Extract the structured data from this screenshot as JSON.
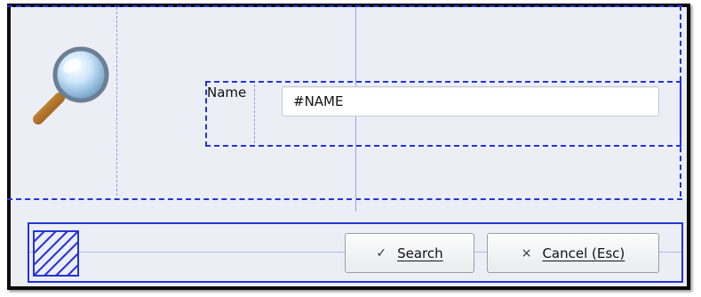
{
  "search_form": {
    "field_label": "Name",
    "field_value": "#NAME",
    "search_button_label": "Search",
    "cancel_button_label": "Cancel (Esc)"
  },
  "icons": {
    "search": "magnifying-glass",
    "hatch": "hatched-square",
    "check": "checkmark",
    "cancel": "x-mark"
  },
  "colors": {
    "guide_blue": "#2633d8",
    "panel_background": "#eceef6"
  }
}
